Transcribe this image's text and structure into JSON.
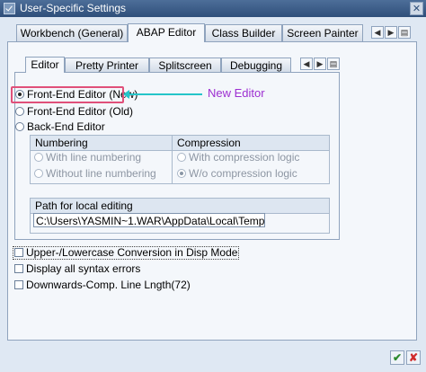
{
  "window": {
    "title": "User-Specific Settings",
    "close_glyph": "✕"
  },
  "tabs": [
    {
      "label": "Workbench (General)"
    },
    {
      "label": "ABAP Editor"
    },
    {
      "label": "Class Builder"
    },
    {
      "label": "Screen Painter"
    }
  ],
  "tab_nav": {
    "left": "◀",
    "right": "▶",
    "menu": "▤"
  },
  "inner_tabs": [
    {
      "label": "Editor"
    },
    {
      "label": "Pretty Printer"
    },
    {
      "label": "Splitscreen"
    },
    {
      "label": "Debugging"
    }
  ],
  "editor_options": [
    {
      "label": "Front-End Editor (New)",
      "selected": true
    },
    {
      "label": "Front-End Editor (Old)",
      "selected": false
    },
    {
      "label": "Back-End Editor",
      "selected": false
    }
  ],
  "numbering": {
    "header": "Numbering",
    "options": [
      {
        "label": "With line numbering"
      },
      {
        "label": "Without line numbering"
      }
    ]
  },
  "compression": {
    "header": "Compression",
    "options": [
      {
        "label": "With compression logic"
      },
      {
        "label": "W/o compression logic"
      }
    ]
  },
  "path": {
    "header": "Path for local editing",
    "value": "C:\\Users\\YASMIN~1.WAR\\AppData\\Local\\Temp"
  },
  "checkboxes": [
    {
      "label": "Upper-/Lowercase Conversion in Disp Mode"
    },
    {
      "label": "Display all syntax errors"
    },
    {
      "label": "Downwards-Comp. Line Lngth(72)"
    }
  ],
  "annotation": {
    "text": "New Editor"
  },
  "footer": {
    "ok_glyph": "✔",
    "cancel_glyph": "✘"
  },
  "colors": {
    "annotation_text": "#9d2fd1",
    "highlight_border": "#e0507a",
    "annotation_arrow": "#25c5c9"
  }
}
